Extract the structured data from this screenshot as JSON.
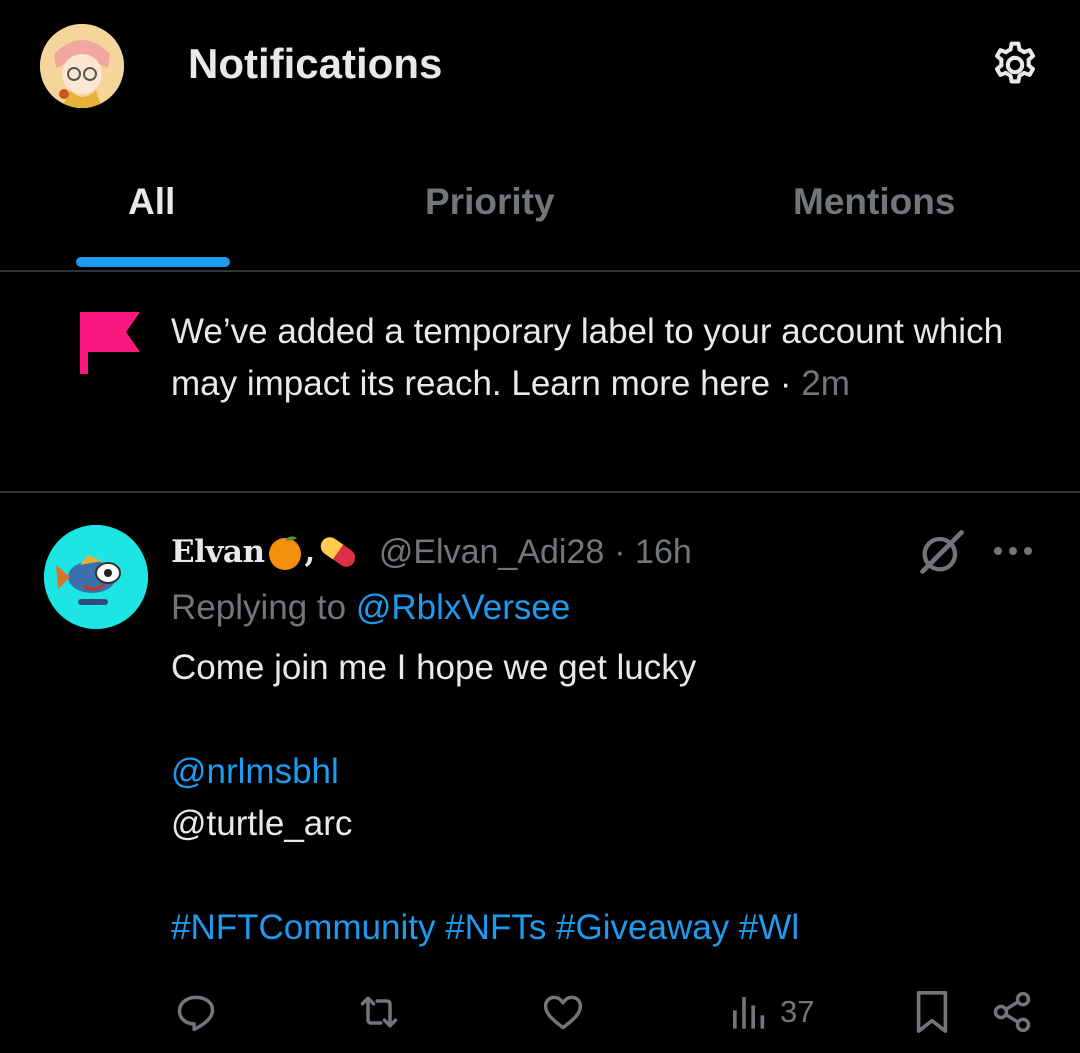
{
  "header": {
    "title": "Notifications"
  },
  "tabs": [
    {
      "label": "All",
      "active": true
    },
    {
      "label": "Priority",
      "active": false
    },
    {
      "label": "Mentions",
      "active": false
    }
  ],
  "notice": {
    "text": "We’ve added a temporary label to your account which may impact its reach. Learn more here · ",
    "time": "2m",
    "icon": "flag-icon",
    "icon_color": "#f91880"
  },
  "tweet": {
    "display_name": "Elvan",
    "name_separator": ",",
    "handle": "@Elvan_Adi28",
    "time": "· 16h",
    "reply_prefix": "Replying to ",
    "reply_to": "@RblxVersee",
    "lines": [
      "Come join me I hope we get lucky",
      "",
      "@nrlmsbhl",
      "@turtle_arc",
      "",
      "#NFTCommunity #NFTs #Giveaway #Wl"
    ],
    "actions": {
      "reply_icon": "reply-icon",
      "retweet_icon": "retweet-icon",
      "like_icon": "heart-icon",
      "views_icon": "views-icon",
      "views_count": "37",
      "bookmark_icon": "bookmark-icon",
      "share_icon": "share-icon"
    }
  },
  "colors": {
    "background": "#000000",
    "text": "#e7e9ea",
    "muted": "#71767b",
    "accent": "#1d9bf0",
    "divider": "#2f3336",
    "flag": "#f91880",
    "avatar_bg": "#1de5e3"
  }
}
